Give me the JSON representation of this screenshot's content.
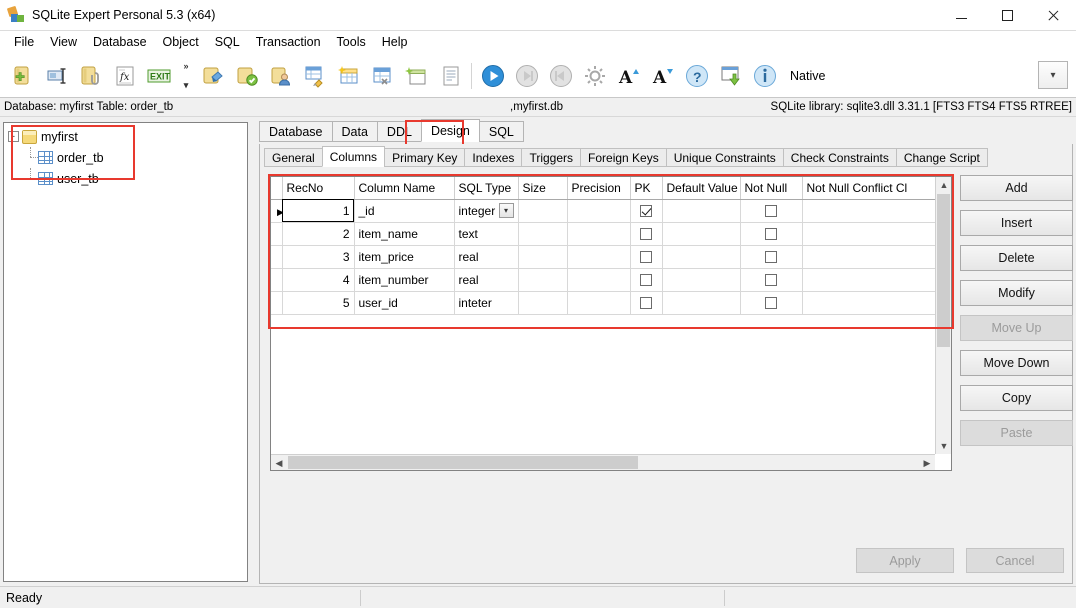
{
  "window": {
    "title": "SQLite Expert Personal 5.3 (x64)",
    "app_icon": "sqlite-expert-icon",
    "controls": {
      "minimize": "minimize",
      "maximize": "maximize",
      "close": "close"
    }
  },
  "menubar": {
    "items": [
      "File",
      "View",
      "Database",
      "Object",
      "SQL",
      "Transaction",
      "Tools",
      "Help"
    ]
  },
  "toolbar": {
    "icons": [
      "new-database-icon",
      "rename-database-icon",
      "attach-database-icon",
      "function-fx-icon",
      "exit-icon"
    ],
    "overflow": "toolbar-overflow-chevron",
    "icons2": [
      "refresh-database-icon",
      "verify-database-icon",
      "database-user-icon",
      "edit-table-icon",
      "new-table-icon",
      "drop-table-icon",
      "new-view-icon",
      "script-icon"
    ],
    "icons3": [
      "execute-icon",
      "step-forward-icon",
      "step-back-icon",
      "options-gear-icon",
      "increase-font-icon",
      "decrease-font-icon",
      "help-icon",
      "import-icon",
      "info-icon"
    ],
    "native_label": "Native",
    "combo_caret": "chevron-down-icon"
  },
  "infobar": {
    "database_label": "Database: myfirst   Table: order_tb",
    "file_name": ",myfirst.db",
    "library": "SQLite library: sqlite3.dll 3.31.1 [FTS3 FTS4 FTS5 RTREE]"
  },
  "tree": {
    "root": {
      "label": "myfirst",
      "icon": "database-icon",
      "expander": "-"
    },
    "children": [
      {
        "label": "order_tb",
        "icon": "table-icon"
      },
      {
        "label": "user_tb",
        "icon": "table-icon"
      }
    ]
  },
  "tabs": {
    "main": [
      {
        "label": "Database",
        "selected": false
      },
      {
        "label": "Data",
        "selected": false
      },
      {
        "label": "DDL",
        "selected": false
      },
      {
        "label": "Design",
        "selected": true
      },
      {
        "label": "SQL",
        "selected": false
      }
    ],
    "sub": [
      {
        "label": "General",
        "selected": false
      },
      {
        "label": "Columns",
        "selected": true
      },
      {
        "label": "Primary Key",
        "selected": false
      },
      {
        "label": "Indexes",
        "selected": false
      },
      {
        "label": "Triggers",
        "selected": false
      },
      {
        "label": "Foreign Keys",
        "selected": false
      },
      {
        "label": "Unique Constraints",
        "selected": false
      },
      {
        "label": "Check Constraints",
        "selected": false
      },
      {
        "label": "Change Script",
        "selected": false
      }
    ]
  },
  "grid": {
    "columns": [
      "RecNo",
      "Column Name",
      "SQL Type",
      "Size",
      "Precision",
      "PK",
      "Default Value",
      "Not Null",
      "Not Null Conflict Cl"
    ],
    "rows": [
      {
        "recno": "1",
        "name": "_id",
        "type": "integer",
        "size": "",
        "precision": "",
        "pk": true,
        "default": "",
        "notnull": false,
        "conflict": "",
        "selected": true,
        "combo": true
      },
      {
        "recno": "2",
        "name": "item_name",
        "type": "text",
        "size": "",
        "precision": "",
        "pk": false,
        "default": "",
        "notnull": false,
        "conflict": "",
        "selected": false,
        "combo": false
      },
      {
        "recno": "3",
        "name": "item_price",
        "type": "real",
        "size": "",
        "precision": "",
        "pk": false,
        "default": "",
        "notnull": false,
        "conflict": "",
        "selected": false,
        "combo": false
      },
      {
        "recno": "4",
        "name": "item_number",
        "type": "real",
        "size": "",
        "precision": "",
        "pk": false,
        "default": "",
        "notnull": false,
        "conflict": "",
        "selected": false,
        "combo": false
      },
      {
        "recno": "5",
        "name": "user_id",
        "type": "inteter",
        "size": "",
        "precision": "",
        "pk": false,
        "default": "",
        "notnull": false,
        "conflict": "",
        "selected": false,
        "combo": false
      }
    ],
    "scroll_up_icon": "chevron-up-icon",
    "scroll_down_icon": "chevron-down-icon",
    "scroll_left_icon": "chevron-left-icon",
    "scroll_right_icon": "chevron-right-icon"
  },
  "side_buttons": [
    {
      "label": "Add",
      "enabled": true
    },
    {
      "label": "Insert",
      "enabled": true
    },
    {
      "label": "Delete",
      "enabled": true
    },
    {
      "label": "Modify",
      "enabled": true
    },
    {
      "label": "Move Up",
      "enabled": false
    },
    {
      "label": "Move Down",
      "enabled": true
    },
    {
      "label": "Copy",
      "enabled": true
    },
    {
      "label": "Paste",
      "enabled": false
    }
  ],
  "bottom_buttons": [
    {
      "label": "Apply",
      "enabled": false
    },
    {
      "label": "Cancel",
      "enabled": false
    }
  ],
  "statusbar": {
    "text": "Ready"
  },
  "colors": {
    "highlight": "#e8392e",
    "accent_blue": "#3b7fc4",
    "window_bg": "#f0f0f0"
  }
}
